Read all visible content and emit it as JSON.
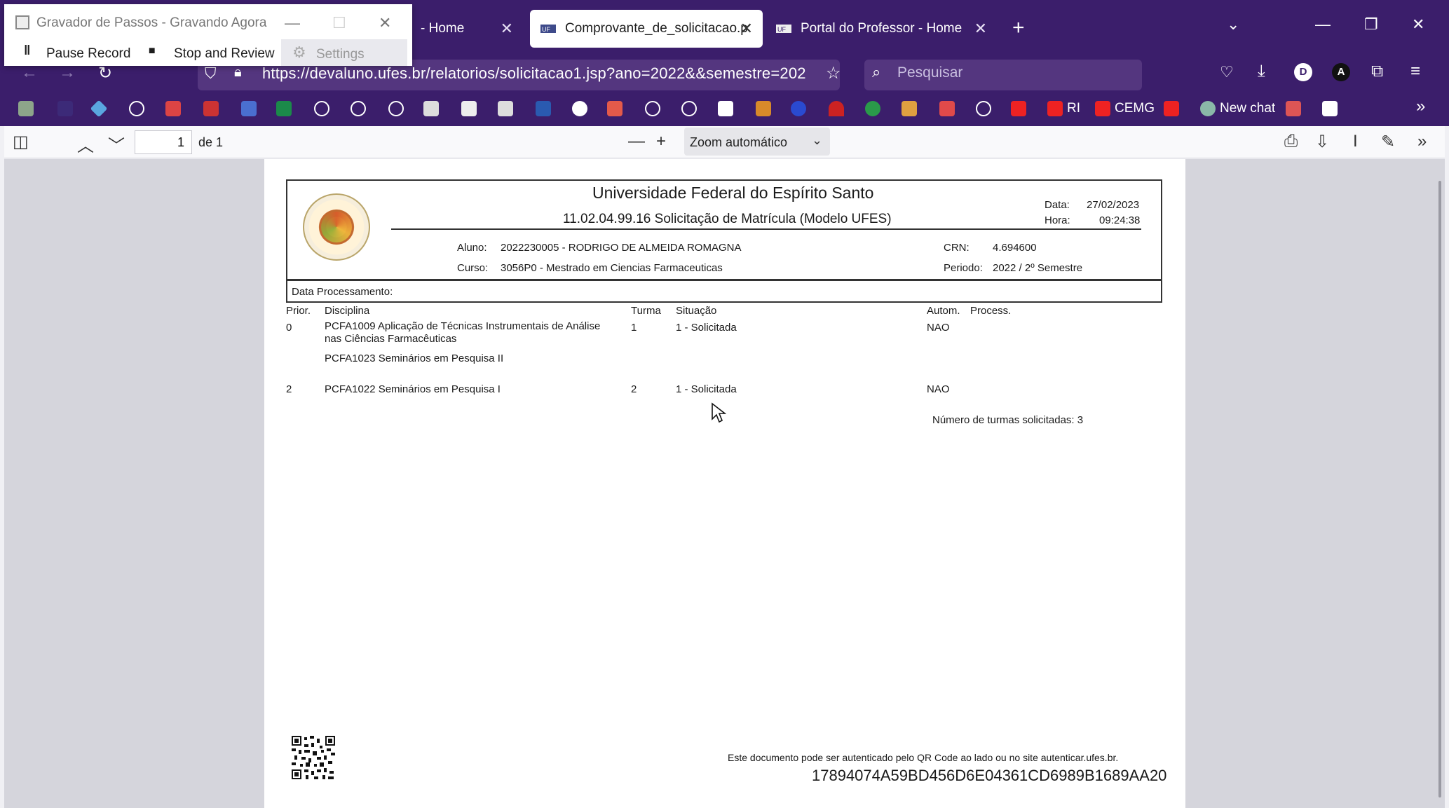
{
  "recorder": {
    "title": "Gravador de Passos - Gravando Agora",
    "pause": "Pause Record",
    "stop": "Stop and Review",
    "settings": "Settings"
  },
  "tabs": [
    {
      "label": "- Home"
    },
    {
      "label": "Comprovante_de_solicitacao.p"
    },
    {
      "label": "Portal do Professor - Home"
    }
  ],
  "address": {
    "url": "https://devaluno.ufes.br/relatorios/solicitacao1.jsp?ano=2022&&semestre=202",
    "search_placeholder": "Pesquisar"
  },
  "bookmarks": {
    "ri": "RI",
    "cemg": "CEMG",
    "new_chat": "New chat"
  },
  "pdf_toolbar": {
    "page": "1",
    "of": "de 1",
    "zoom": "Zoom automático"
  },
  "doc": {
    "university": "Universidade Federal do Espírito Santo",
    "report_title": "11.02.04.99.16 Solicitação de Matrícula (Modelo UFES)",
    "date_label": "Data:",
    "date_value": "27/02/2023",
    "time_label": "Hora:",
    "time_value": "09:24:38",
    "student_label": "Aluno:",
    "student_value": "2022230005 - RODRIGO DE ALMEIDA ROMAGNA",
    "course_label": "Curso:",
    "course_value": "3056P0 - Mestrado em Ciencias Farmaceuticas",
    "crn_label": "CRN:",
    "crn_value": "4.694600",
    "period_label": "Periodo:",
    "period_value": "2022 / 2º Semestre",
    "processing_label": "Data Processamento:",
    "columns": {
      "prior": "Prior.",
      "discipline": "Disciplina",
      "class": "Turma",
      "status": "Situação",
      "autom": "Autom.",
      "process": "Process."
    },
    "rows": [
      {
        "prior": "0",
        "discipline": "PCFA1009 Aplicação de Técnicas Instrumentais de Análise",
        "discipline_2": "nas Ciências Farmacêuticas",
        "class": "1",
        "status": "1 - Solicitada",
        "autom": "NAO"
      },
      {
        "prior": "",
        "discipline": "PCFA1023 Seminários em Pesquisa II",
        "class": "",
        "status": "",
        "autom": ""
      },
      {
        "prior": "2",
        "discipline": "PCFA1022 Seminários em Pesquisa I",
        "class": "2",
        "status": "1 - Solicitada",
        "autom": "NAO"
      }
    ],
    "total": "Número de turmas solicitadas: 3",
    "auth_note": "Este documento pode ser autenticado pelo QR Code ao lado ou no site autenticar.ufes.br.",
    "hash": "17894074A59BD456D6E04361CD6989B1689AA20"
  }
}
